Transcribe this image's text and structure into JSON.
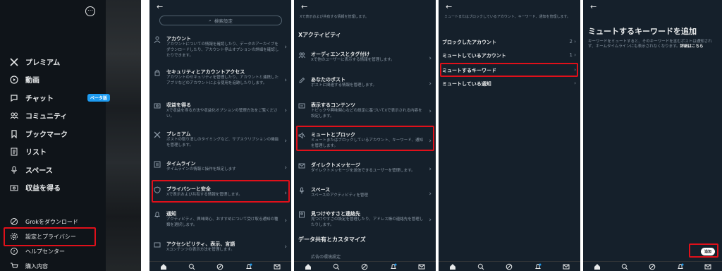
{
  "panel1": {
    "nav": [
      {
        "label": "プレミアム",
        "icon": "x-logo-icon"
      },
      {
        "label": "動画",
        "icon": "play-circle-icon"
      },
      {
        "label": "チャット",
        "icon": "chat-bubble-icon",
        "badge": "ベータ版"
      },
      {
        "label": "コミュニティ",
        "icon": "people-icon"
      },
      {
        "label": "ブックマーク",
        "icon": "bookmark-icon"
      },
      {
        "label": "リスト",
        "icon": "list-icon"
      },
      {
        "label": "スペース",
        "icon": "microphone-icon"
      },
      {
        "label": "収益を得る",
        "icon": "money-icon"
      }
    ],
    "bottom": [
      {
        "label": "Grokをダウンロード",
        "icon": "grok-icon"
      },
      {
        "label": "設定とプライバシー",
        "icon": "gear-icon"
      },
      {
        "label": "ヘルプセンター",
        "icon": "help-icon"
      },
      {
        "label": "購入内容",
        "icon": "cart-icon"
      }
    ]
  },
  "panel2": {
    "back": "←",
    "search_placeholder": "検索設定",
    "items": [
      {
        "title": "アカウント",
        "desc": "アカウントについての情報を確認したり、データのアーカイブをダウンロードしたり、アカウント停止オプションの詳細を確認したりできます。"
      },
      {
        "title": "セキュリティとアカウントアクセス",
        "desc": "アカウントのセキュリティを管理したり、アカウントと連携したアプリなどのアカウントによる使用を追跡したりします。"
      },
      {
        "title": "収益を得る",
        "desc": "Xで収益を得る方法や収益化オプションの管理方法をご覧ください。"
      },
      {
        "title": "プレミアム",
        "desc": "ポストの取り消しのタイミングなど、サブスクリプションの機能を管理します。"
      },
      {
        "title": "タイムライン",
        "desc": "タイムラインの情報と操作を設定します"
      },
      {
        "title": "プライバシーと安全",
        "desc": "Xで表示および共有する情報を管理します。"
      },
      {
        "title": "通知",
        "desc": "アクティビティ、興味関心、おすすめについて受け取る通知の種類を選択します。"
      },
      {
        "title": "アクセシビリティ、表示、言語",
        "desc": "Xコンテンツの表示方法を管理します。"
      }
    ]
  },
  "panel3": {
    "back": "←",
    "top_note": "Xで表示および共有する情報を管理します。",
    "section1": "Xアクティビティ",
    "items": [
      {
        "title": "オーディエンスとタグ付け",
        "desc": "Xで他のユーザーに表示する情報を管理します。"
      },
      {
        "title": "あなたのポスト",
        "desc": "ポストに関連する情報を管理します。"
      },
      {
        "title": "表示するコンテンツ",
        "desc": "トピックや興味関心などの設定に基づいてXで表示される内容を設定します。"
      },
      {
        "title": "ミュートとブロック",
        "desc": "ミュートまたはブロックしているアカウント、キーワード、通知を管理します。"
      },
      {
        "title": "ダイレクトメッセージ",
        "desc": "ダイレクトメッセージを送信できるユーザーを管理します。"
      },
      {
        "title": "スペース",
        "desc": "スペースのアクティビティを管理"
      },
      {
        "title": "見つけやすさと連絡先",
        "desc": "見つけやすさの設定を管理したり、アドレス帳の連絡先を管理したりします。"
      }
    ],
    "section2": "データ共有とカスタマイズ",
    "last_item": "広告の環境設定"
  },
  "panel4": {
    "back": "←",
    "top_note": "ミュートまたはブロックしているアカウント、キーワード、通知を管理します。",
    "rows": [
      {
        "label": "ブロックしたアカウント",
        "value": "2"
      },
      {
        "label": "ミュートしているアカウント",
        "value": "1"
      },
      {
        "label": "ミュートするキーワード",
        "value": ""
      },
      {
        "label": "ミュートしている通知",
        "value": ""
      }
    ]
  },
  "panel5": {
    "back": "←",
    "title": "ミュートするキーワードを追加",
    "desc": "キーワードをミュートすると、そのキーワードを含むポストは通知されず、ホームタイムラインにも表示されなくなります。",
    "link": "詳細はこちら",
    "add_button": "追加"
  },
  "tabbar_icons": [
    "home-icon",
    "search-icon",
    "grok-icon",
    "notifications-icon",
    "messages-icon"
  ],
  "colors": {
    "highlight": "#e0101a",
    "accent": "#1d9bf0",
    "background": "#15202b"
  }
}
